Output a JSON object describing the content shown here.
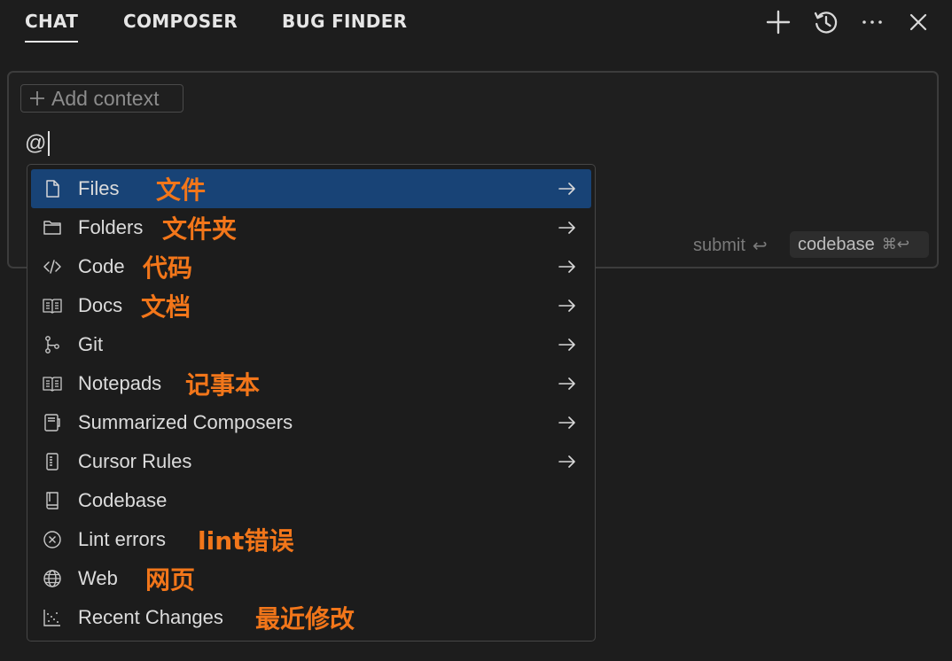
{
  "tabs": [
    {
      "label": "CHAT",
      "active": true
    },
    {
      "label": "COMPOSER",
      "active": false
    },
    {
      "label": "BUG FINDER",
      "active": false
    }
  ],
  "toolbar_icons": [
    "plus-icon",
    "history-icon",
    "more-icon",
    "close-icon"
  ],
  "panel": {
    "add_context_label": "Add context",
    "input_value": "@",
    "submit_label": "submit",
    "submit_key": "↩",
    "codebase_label": "codebase",
    "codebase_keys": "⌘↩"
  },
  "menu": {
    "items": [
      {
        "label": "Files",
        "annotation": "文件",
        "icon": "file-icon",
        "has_submenu": true,
        "selected": true
      },
      {
        "label": "Folders",
        "annotation": "文件夹",
        "icon": "folder-icon",
        "has_submenu": true
      },
      {
        "label": "Code",
        "annotation": "代码",
        "icon": "code-icon",
        "has_submenu": true
      },
      {
        "label": "Docs",
        "annotation": "文档",
        "icon": "book-icon",
        "has_submenu": true
      },
      {
        "label": "Git",
        "annotation": "",
        "icon": "git-branch-icon",
        "has_submenu": true
      },
      {
        "label": "Notepads",
        "annotation": "记事本",
        "icon": "notepad-icon",
        "has_submenu": true
      },
      {
        "label": "Summarized Composers",
        "annotation": "",
        "icon": "composer-icon",
        "has_submenu": true
      },
      {
        "label": "Cursor Rules",
        "annotation": "",
        "icon": "rules-icon",
        "has_submenu": true
      },
      {
        "label": "Codebase",
        "annotation": "",
        "icon": "codebase-icon",
        "has_submenu": false
      },
      {
        "label": "Lint errors",
        "annotation": "lint错误",
        "icon": "error-circle-icon",
        "has_submenu": false
      },
      {
        "label": "Web",
        "annotation": "网页",
        "icon": "globe-icon",
        "has_submenu": false
      },
      {
        "label": "Recent Changes",
        "annotation": "最近修改",
        "icon": "recent-changes-icon",
        "has_submenu": false
      }
    ]
  },
  "colors": {
    "background": "#1d1d1d",
    "selected_item": "#184376",
    "annotation": "#f2761a"
  }
}
